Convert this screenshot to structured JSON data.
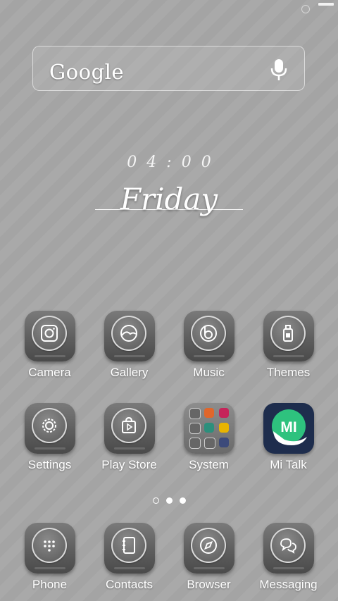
{
  "search": {
    "label": "Google"
  },
  "clock": {
    "time": "04:00",
    "day": "Friday"
  },
  "apps_row1": [
    {
      "label": "Camera",
      "icon": "camera-icon"
    },
    {
      "label": "Gallery",
      "icon": "gallery-icon"
    },
    {
      "label": "Music",
      "icon": "music-icon"
    },
    {
      "label": "Themes",
      "icon": "themes-icon"
    }
  ],
  "apps_row2": [
    {
      "label": "Settings",
      "icon": "settings-icon"
    },
    {
      "label": "Play Store",
      "icon": "play-store-icon"
    },
    {
      "label": "System",
      "icon": "folder-icon"
    },
    {
      "label": "Mi Talk",
      "icon": "mi-talk-icon",
      "brand_color": "#1e2d4d",
      "accent": "#2ec27e"
    }
  ],
  "dock": [
    {
      "label": "Phone",
      "icon": "phone-dialpad-icon"
    },
    {
      "label": "Contacts",
      "icon": "contacts-icon"
    },
    {
      "label": "Browser",
      "icon": "compass-icon"
    },
    {
      "label": "Messaging",
      "icon": "messaging-icon"
    }
  ],
  "pages": {
    "total": 3,
    "current": 2
  }
}
